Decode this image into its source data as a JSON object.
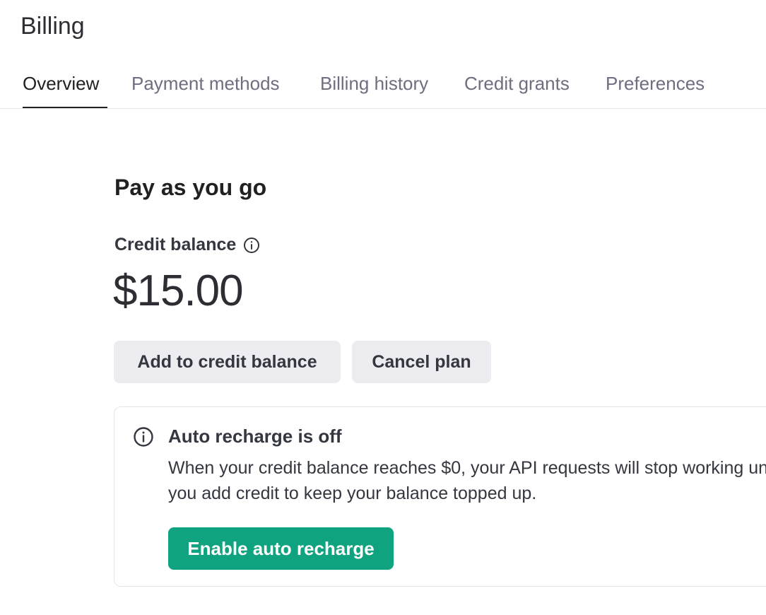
{
  "page": {
    "title": "Billing"
  },
  "tabs": [
    {
      "label": "Overview",
      "active": true
    },
    {
      "label": "Payment methods",
      "active": false
    },
    {
      "label": "Billing history",
      "active": false
    },
    {
      "label": "Credit grants",
      "active": false
    },
    {
      "label": "Preferences",
      "active": false
    }
  ],
  "plan": {
    "title": "Pay as you go",
    "balance_label": "Credit balance",
    "balance_value": "$15.00",
    "add_credit_label": "Add to credit balance",
    "cancel_plan_label": "Cancel plan"
  },
  "auto_recharge": {
    "title": "Auto recharge is off",
    "body": "When your credit balance reaches $0, your API requests will stop working until you add credit to keep your balance topped up.",
    "enable_label": "Enable auto recharge"
  },
  "colors": {
    "accent": "#10a37f",
    "button_secondary": "#ececf1",
    "border": "#e5e5e5"
  },
  "icons": {
    "info": "info-circle-icon"
  }
}
